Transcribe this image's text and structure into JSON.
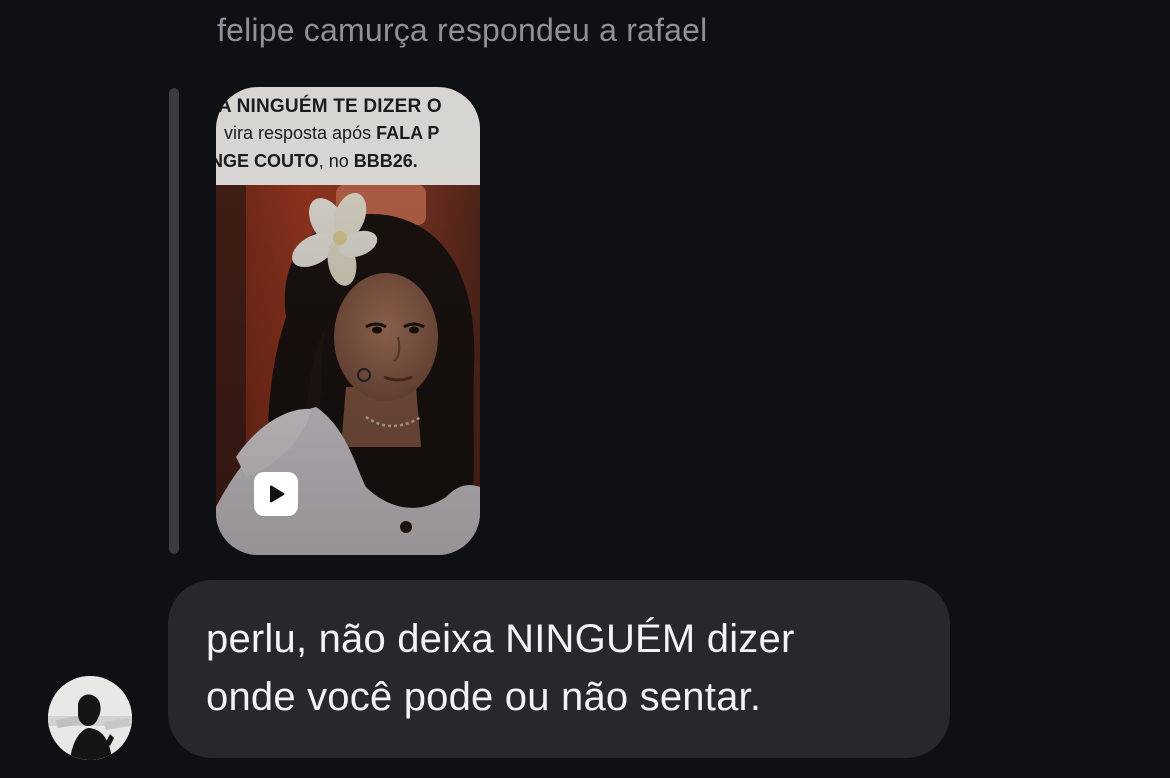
{
  "reply": {
    "header": "felipe camurça respondeu a rafael"
  },
  "media": {
    "caption_line1": "RA NINGUÉM TE DIZER O",
    "caption_line2_a": "vira resposta após ",
    "caption_line2_b": "FALA P",
    "caption_line3_a": "NGE COUTO",
    "caption_line3_b": ", no ",
    "caption_line3_c": "BBB26.",
    "type_icon": "play-icon"
  },
  "message": {
    "text_line1": "perlu, não deixa NINGUÉM dizer",
    "text_line2": "onde você pode ou não sentar."
  },
  "avatar": {
    "icon": "profile-silhouette-avatar"
  },
  "colors": {
    "background": "#0e1013",
    "bubble": "#26282c",
    "header_text": "#8e9199",
    "message_text": "#f2f3f5",
    "reply_bar": "#3a3c41"
  }
}
